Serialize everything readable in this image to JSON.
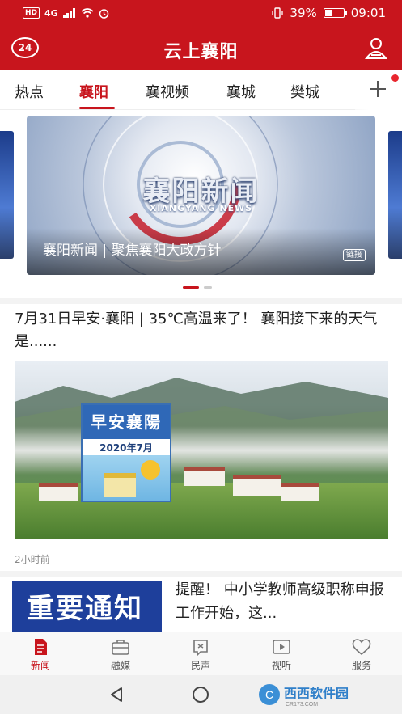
{
  "status_bar": {
    "left_badge": "HD",
    "network": "4G",
    "battery_percent_label": "39%",
    "battery_level": 0.39,
    "time": "09:01"
  },
  "header": {
    "badge_label": "24",
    "title": "云上襄阳",
    "user_icon": "user-icon"
  },
  "tabs": {
    "items": [
      "热点",
      "襄阳",
      "襄视频",
      "襄城",
      "樊城"
    ],
    "active_index": 1,
    "more_icon": "plus-icon"
  },
  "carousel": {
    "banner_title": "襄阳新闻",
    "banner_subtitle": "XIANGYANG NEWS",
    "caption": "襄阳新闻 | 聚焦襄阳大政方针",
    "tag": "链接",
    "slide_count": 2,
    "active_slide": 0
  },
  "articles": [
    {
      "title": "7月31日早安·襄阳 | 35℃高温来了！ 襄阳接下来的天气是......",
      "image_poster_title": "早安襄陽",
      "image_poster_date": "2020年7月",
      "time": "2小时前"
    },
    {
      "title": "提醒！ 中小学教师高级职称申报工作开始，这...",
      "image_text": "重要通知"
    }
  ],
  "bottom_nav": {
    "items": [
      {
        "label": "新闻",
        "icon": "news-icon"
      },
      {
        "label": "融媒",
        "icon": "briefcase-icon"
      },
      {
        "label": "民声",
        "icon": "feedback-icon"
      },
      {
        "label": "视听",
        "icon": "video-icon"
      },
      {
        "label": "服务",
        "icon": "heart-icon"
      }
    ],
    "active_index": 0
  },
  "watermark": {
    "text": "西西软件园",
    "subtext": "CR173.COM"
  },
  "colors": {
    "brand_red": "#c8151d",
    "tab_active": "#c8151d",
    "text_dark": "#222222",
    "text_muted": "#888888"
  }
}
